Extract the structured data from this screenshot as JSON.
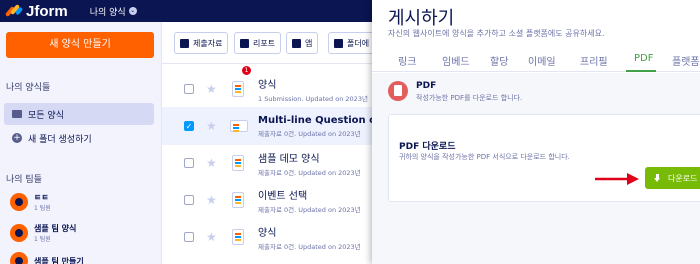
{
  "app": {
    "logo_text": "Jform",
    "workspace_title": "나의 양식",
    "workspace_chevron": "⌄"
  },
  "sidebar": {
    "create_button": "새 양식 만들기",
    "my_forms_title": "나의 양식들",
    "items": [
      {
        "label": "모든 양식",
        "icon": "folder-icon",
        "active": true
      },
      {
        "label": "새 폴더 생성하기",
        "icon": "plus-icon",
        "active": false
      }
    ],
    "teams_title": "나의 팀들",
    "teams": [
      {
        "name": "ㅌㅌ",
        "sub": "1 팀원"
      },
      {
        "name": "샘플 팀 양식",
        "sub": "1 팀원"
      },
      {
        "name": "샘플 팀 만들기",
        "sub": ""
      }
    ]
  },
  "toolbar": {
    "buttons": [
      "제출자료",
      "리포트",
      "앱",
      "폴더에"
    ]
  },
  "forms": [
    {
      "title": "양식",
      "sub": "1 Submission. Updated on 2023년",
      "checked": false,
      "badge": "1",
      "bold": false
    },
    {
      "title": "Multi-line Question card",
      "sub": "제출자료 0건. Updated on 2023년",
      "checked": true,
      "badge": "",
      "bold": true
    },
    {
      "title": "샘플 데모 양식",
      "sub": "제출자료 0건. Updated on 2023년",
      "checked": false,
      "badge": "",
      "bold": false
    },
    {
      "title": "이벤트 선택",
      "sub": "제출자료 0건. Updated on 2023년",
      "checked": false,
      "badge": "",
      "bold": false
    },
    {
      "title": "양식",
      "sub": "제출자료 0건. Updated on 2023년",
      "checked": false,
      "badge": "",
      "bold": false
    }
  ],
  "panel": {
    "title": "게시하기",
    "description": "자신의 웹사이트에 양식을 추가하고 소셜 플랫폼에도 공유하세요.",
    "tabs": [
      "링크",
      "임베드",
      "할당",
      "이메일",
      "프리필",
      "PDF",
      "플랫폼"
    ],
    "active_tab": "PDF",
    "pdf_title": "PDF",
    "pdf_desc": "작성가능한 PDF를 다운로드 합니다.",
    "card_title": "PDF 다운로드",
    "card_desc": "귀하의 양식을 작성가능한 PDF 서식으로 다운로드 합니다.",
    "download_button": "다운로드"
  },
  "colors": {
    "accent": "#ff6100",
    "navy": "#0a1551",
    "green_button": "#78bb07",
    "tab_active": "#43a047",
    "arrow": "#e0001a"
  }
}
